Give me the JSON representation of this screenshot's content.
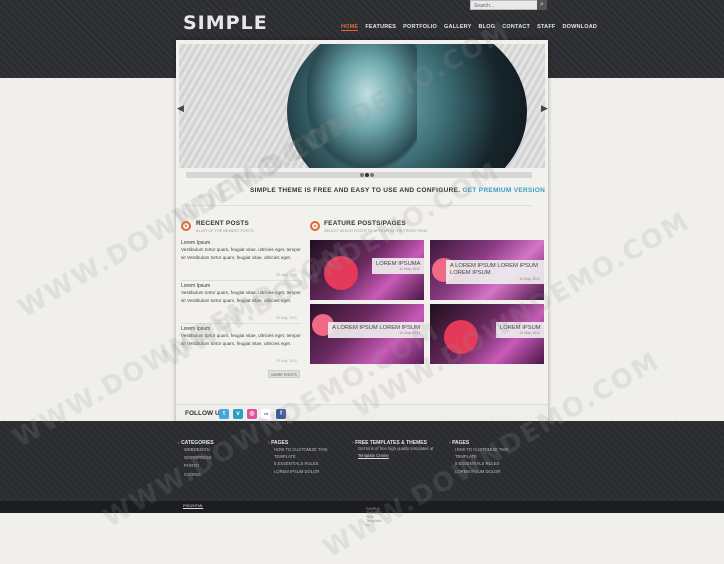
{
  "header": {
    "logo": "SIMPLE",
    "search_placeholder": "Search...",
    "search_button_icon": "magnifier-icon",
    "nav": [
      "HOME",
      "FEATURES",
      "PORTFOLIO",
      "GALLERY",
      "BLOG",
      "CONTACT",
      "STAFF",
      "DOWNLOAD"
    ],
    "active_nav": "HOME"
  },
  "slider": {
    "prev_icon": "chevron-left-icon",
    "next_icon": "chevron-right-icon",
    "dot_count": 3,
    "active_dot": 2
  },
  "tagline": {
    "text": "SIMPLE THEME IS FREE AND EASY TO USE AND CONFIGURE.",
    "link": "GET PREMIUM VERSION"
  },
  "recent_posts": {
    "title": "RECENT POSTS",
    "subtitle": "A LIST OF THE NEWEST POSTS",
    "posts": [
      {
        "title": "Lorem Ipsum",
        "text": "Vestibulum tortor quam, feugiat vitae, ultricies eget, tempor sit Vestibulum tortor quam, feugiat vitae, ultricies eget.",
        "date": "20 May, 2011"
      },
      {
        "title": "Lorem Ipsum",
        "text": "Vestibulum tortor quam, feugiat vitae, ultricies eget, tempor sit Vestibulum tortor quam, feugiat vitae, ultricies eget.",
        "date": "20 May, 2011"
      },
      {
        "title": "Lorem Ipsum",
        "text": "Vestibulum tortor quam, feugiat vitae, ultricies eget, tempor sit Vestibulum tortor quam, feugiat vitae, ultricies eget.",
        "date": "20 May, 2011"
      }
    ],
    "more_label": "MORE POSTS"
  },
  "feature_posts": {
    "title": "FEATURE POSTS/PAGES",
    "subtitle": "SELECT WHICH POSTS TO APPEAR IN THE FRONT PAGE",
    "items": [
      {
        "title": "LOREM IPSUMA",
        "date": "10 May, 2011"
      },
      {
        "title": "A LOREM IPSUM LOREM IPSUM LOREM IPSUM",
        "date": "10 May, 2011"
      },
      {
        "title": "A LOREM IPSUM LOREM IPSUM",
        "date": "10 May, 2011"
      },
      {
        "title": "LOREM IPSUM",
        "date": "10 May, 2011"
      }
    ]
  },
  "follow": {
    "label": "FOLLOW US",
    "icons": [
      {
        "name": "twitter-icon",
        "glyph": "t",
        "color": "#3fa9dd"
      },
      {
        "name": "vimeo-icon",
        "glyph": "v",
        "color": "#2aa0c8"
      },
      {
        "name": "dribbble-icon",
        "glyph": "◎",
        "color": "#e0509c"
      },
      {
        "name": "flickr-icon",
        "glyph": "●●",
        "color": "#ffffff"
      },
      {
        "name": "facebook-icon",
        "glyph": "f",
        "color": "#3b5a9a"
      }
    ]
  },
  "footer": {
    "columns": [
      {
        "title": "CATEGORIES",
        "items": [
          "WEBDESIGN",
          "WORDPRESS",
          "PHOTO",
          "CODING"
        ]
      },
      {
        "title": "PAGES",
        "items": [
          "HOW TO CUSTOMIZE THIS TEMPLATE",
          "5 ESSENTIALS RULES",
          "LOREM IPSUM DOLOR"
        ]
      },
      {
        "title": "FREE TEMPLATES & THEMES",
        "text": "Get tons of free high quality templates at",
        "link": "Template Creme"
      },
      {
        "title": "PAGES",
        "items": [
          "HOW TO CUSTOMIZE THIS TEMPLATE",
          "5 ESSENTIALS RULES",
          "LOREM IPSUM DOLOR"
        ]
      }
    ],
    "copyright": "SIMPLE THEME | Web Template by",
    "copyright_link": "PSD2HTML"
  },
  "watermark": "WWW.DOWNDEMO.COM"
}
